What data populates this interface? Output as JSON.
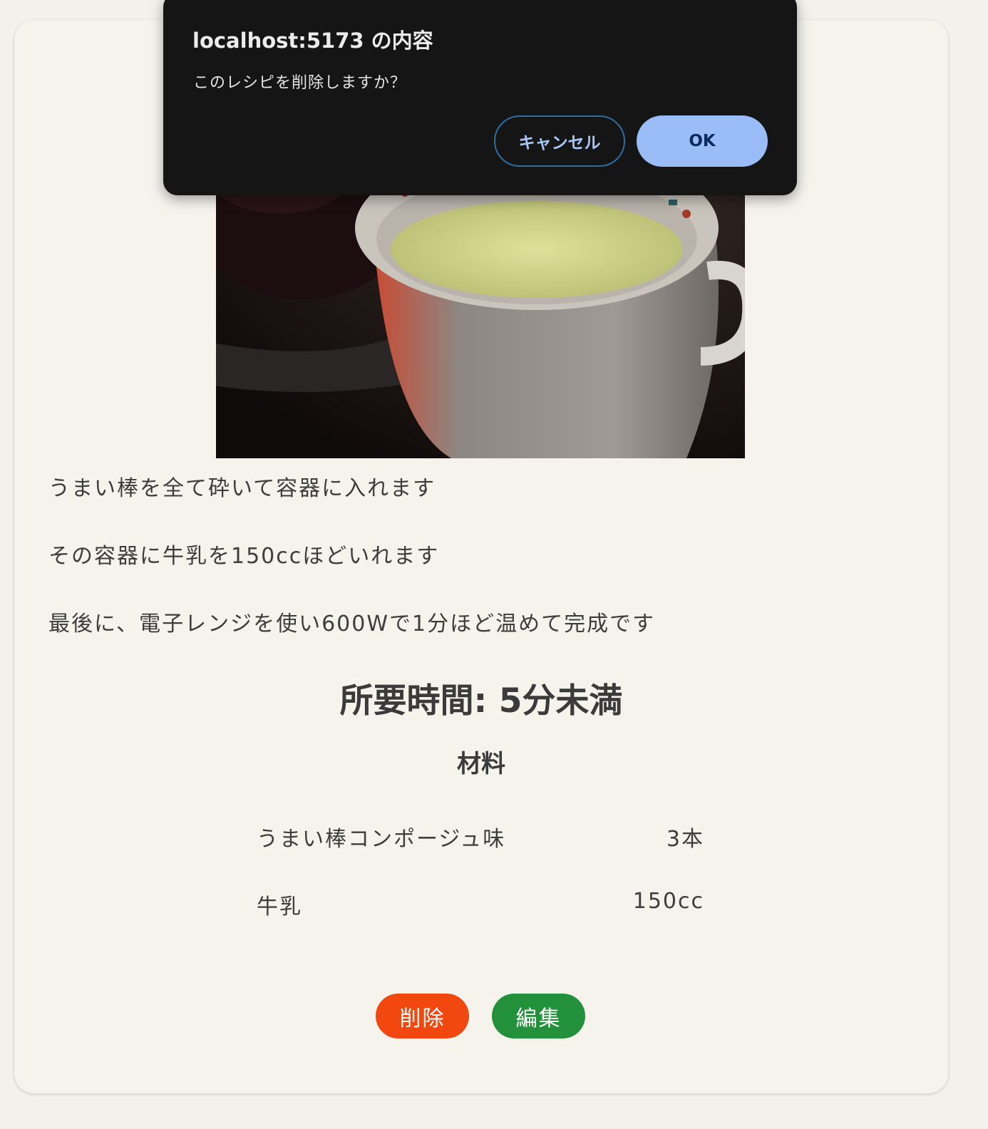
{
  "recipe": {
    "steps": [
      "うまい棒を全て砕いて容器に入れます",
      "その容器に牛乳を150ccほどいれます",
      "最後に、電子レンジを使い600Wで1分ほど温めて完成です"
    ],
    "time_label": "所要時間: 5分未満",
    "ingredients_title": "材料",
    "ingredients": [
      {
        "name": "うまい棒コンポージュ味",
        "amount": "3本"
      },
      {
        "name": "牛乳",
        "amount": "150cc"
      }
    ],
    "buttons": {
      "delete_label": "削除",
      "edit_label": "編集"
    }
  },
  "dialog": {
    "title": "localhost:5173 の内容",
    "message": "このレシピを削除しますか？",
    "cancel_label": "キャンセル",
    "ok_label": "OK"
  },
  "colors": {
    "delete_button": "#f2480f",
    "edit_button": "#23913b",
    "dialog_background": "#151515",
    "dialog_ok": "#9abdf7"
  }
}
